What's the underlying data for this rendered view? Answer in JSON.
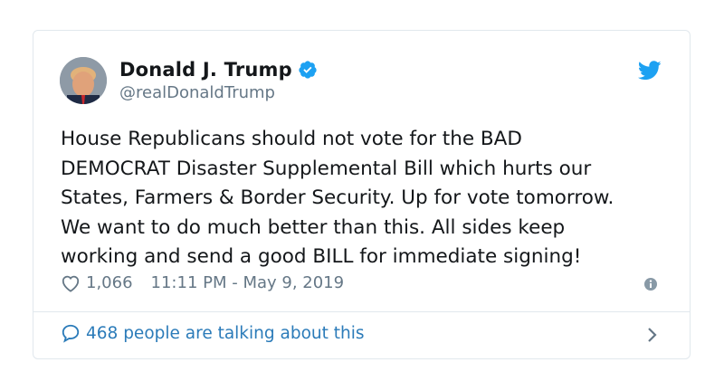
{
  "tweet": {
    "author_name": "Donald J. Trump",
    "author_handle": "@realDonaldTrump",
    "text": "House Republicans should not vote for the BAD\nDEMOCRAT Disaster Supplemental Bill which hurts our\nStates, Farmers & Border Security. Up for vote tomorrow.\nWe want to do much better than this. All sides keep\nworking and send a good BILL for immediate signing!",
    "likes": "1,066",
    "timestamp": "11:11 PM - May 9, 2019",
    "conversation_label": "468 people are talking about this"
  },
  "icons": {
    "verified": "verified-badge-icon",
    "brand": "twitter-bird-icon",
    "like": "heart-icon",
    "info": "info-icon",
    "reply": "speech-bubble-icon",
    "chevron": "chevron-right-icon"
  },
  "colors": {
    "accent": "#1da1f2",
    "link": "#2b7bb9",
    "muted": "#657786",
    "border": "#e1e8ed"
  }
}
